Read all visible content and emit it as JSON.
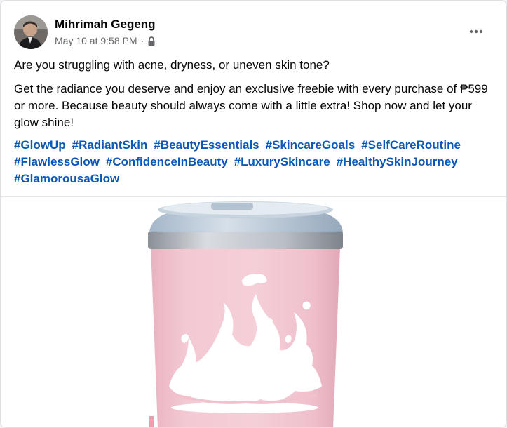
{
  "post": {
    "author": "Mihrimah Gegeng",
    "timestamp": "May 10 at 9:58 PM",
    "separator": "·",
    "privacy_icon": "lock-icon",
    "more_icon": "more-horizontal-icon",
    "line1": "Are you struggling with acne, dryness, or uneven skin tone?",
    "line2": "Get the radiance you deserve and enjoy an exclusive freebie with every purchase of ₱599 or more. Because beauty should always come with a little extra! Shop now and let your glow shine!",
    "hashtags": [
      "#GlowUp",
      "#RadiantSkin",
      "#BeautyEssentials",
      "#SkincareGoals",
      "#SelfCareRoutine",
      "#FlawlessGlow",
      "#ConfidenceInBeauty",
      "#LuxurySkincare",
      "#HealthySkinJourney",
      "#GlamorousaGlow"
    ]
  },
  "colors": {
    "hashtag": "#0a58b8",
    "tumbler_pink": "#f2c6d0",
    "lid_blue": "#b7c7d6"
  }
}
